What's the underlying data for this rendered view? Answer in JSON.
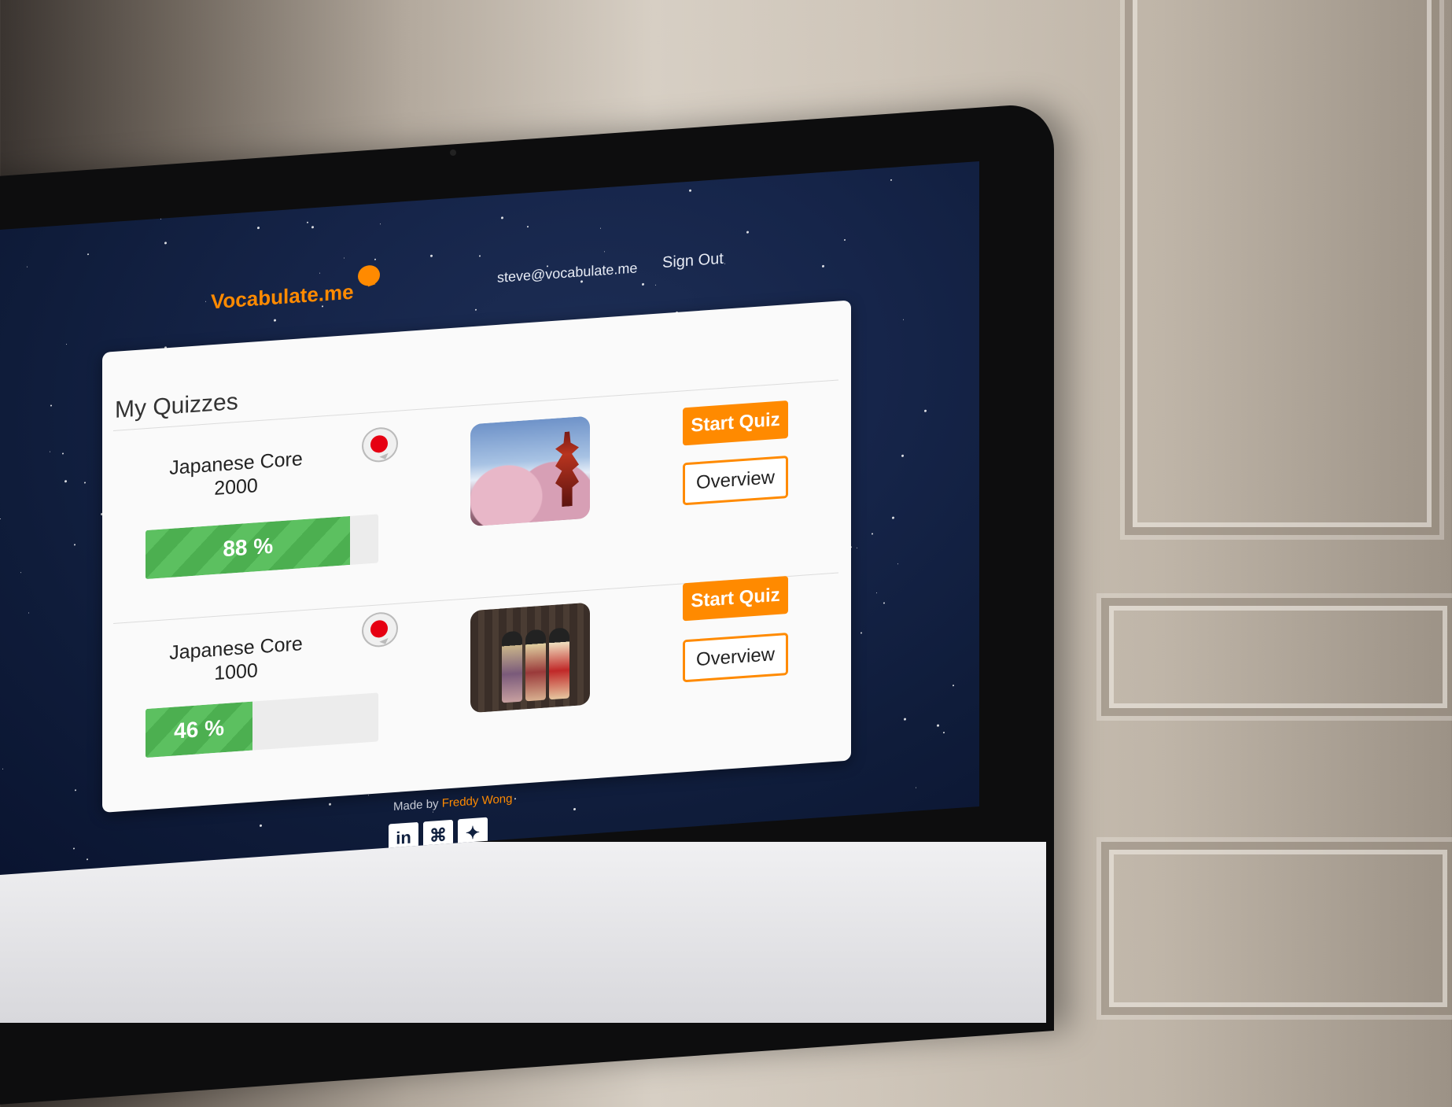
{
  "header": {
    "logo": "Vocabulate.me",
    "user_email": "steve@vocabulate.me",
    "sign_out": "Sign Out"
  },
  "main": {
    "title": "My Quizzes",
    "quizzes": [
      {
        "name": "Japanese Core 2000",
        "progress_percent": 88,
        "progress_label": "88 %",
        "start_label": "Start Quiz",
        "overview_label": "Overview",
        "thumbnail": "mount-fuji-pagoda-image",
        "flag_icon": "japan-flag-bubble-icon"
      },
      {
        "name": "Japanese Core 1000",
        "progress_percent": 46,
        "progress_label": "46 %",
        "start_label": "Start Quiz",
        "overview_label": "Overview",
        "thumbnail": "geisha-street-image",
        "flag_icon": "japan-flag-bubble-icon"
      }
    ]
  },
  "footer": {
    "made_by_prefix": "Made by",
    "author": "Freddy Wong",
    "social": [
      {
        "name": "linkedin-icon",
        "glyph": "in"
      },
      {
        "name": "github-icon",
        "glyph": "⌘"
      },
      {
        "name": "twitter-icon",
        "glyph": "✦"
      }
    ]
  },
  "colors": {
    "accent": "#ff8a00",
    "progress": "#4caf50",
    "background": "#16254a"
  }
}
